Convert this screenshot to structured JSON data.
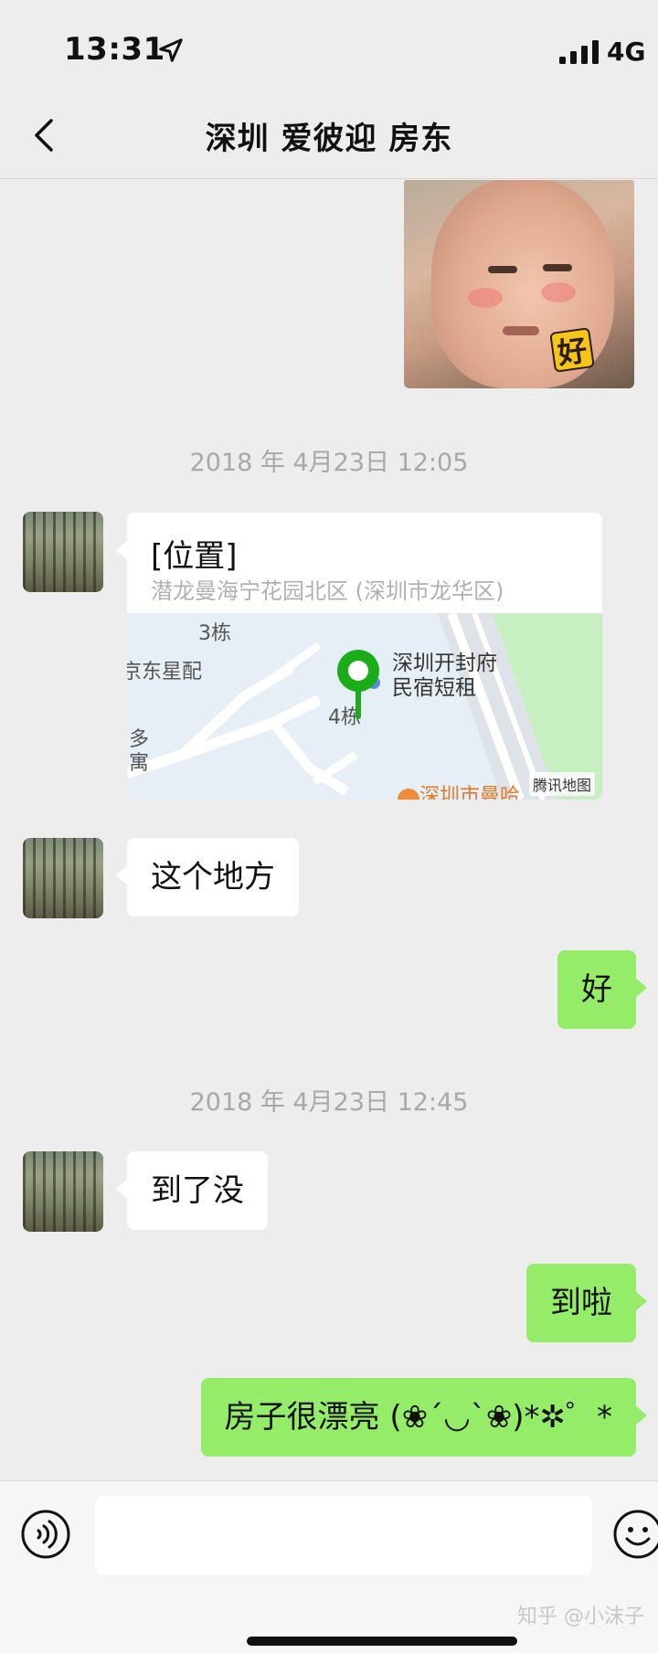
{
  "status_bar": {
    "time": "13:31",
    "network": "4G"
  },
  "nav": {
    "title": "深圳 爱彼迎 房东",
    "back_icon": "chevron-left-icon"
  },
  "messages": {
    "sticker_text": "好",
    "timestamp_1": "2018 年 4月23日 12:05",
    "location": {
      "title": "[位置]",
      "address": "潜龙曼海宁花园北区 (深圳市龙华区)",
      "map_labels": {
        "building_3": "3栋",
        "building_4": "4栋",
        "east_star": "京东星配",
        "duo": "多",
        "yu": "寓",
        "poi_name": "深圳开封府\n民宿短租",
        "bottom_partial": "深圳市曼哈",
        "map_brand": "腾讯地图"
      }
    },
    "msg_1": "这个地方",
    "msg_2": "好",
    "timestamp_2": "2018 年 4月23日 12:45",
    "msg_3": "到了没",
    "msg_4": "到啦",
    "msg_5": "房子很漂亮 (❀´◡`❀)*✲゜*"
  },
  "input_bar": {
    "voice_icon": "voice-icon",
    "emoji_icon": "emoji-icon",
    "input_value": "",
    "watermark": "知乎 @小沫子"
  },
  "colors": {
    "background": "#ededed",
    "self_bubble": "#95ec69",
    "other_bubble": "#ffffff",
    "pin": "#1aad19"
  }
}
